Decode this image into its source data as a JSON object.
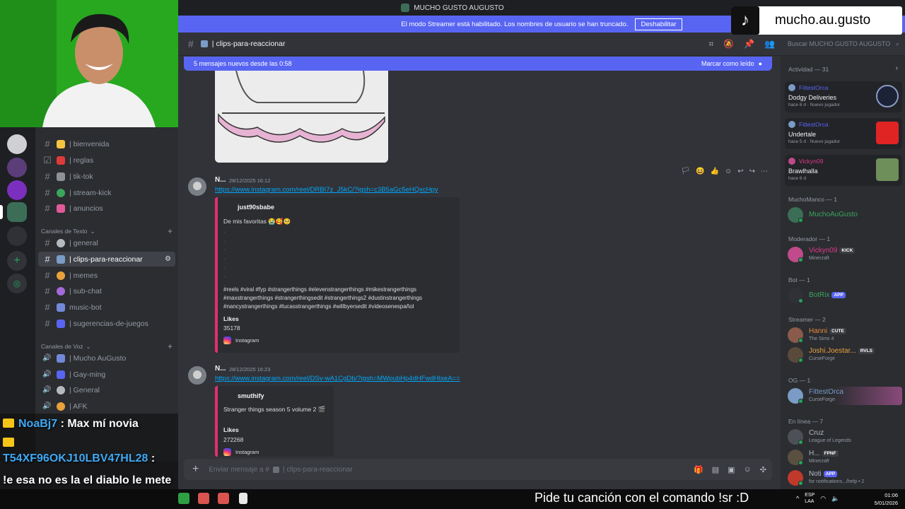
{
  "window": {
    "title": "MUCHO GUSTO AUGUSTO"
  },
  "banner": {
    "text": "El modo Streamer está habilitado. Los nombres de usuario se han truncado.",
    "button": "Deshabilitar"
  },
  "header": {
    "channel": "| clips-para-reaccionar",
    "search_placeholder": "Buscar MUCHO GUSTO AUGUSTO"
  },
  "new_messages": {
    "text": "5 mensajes nuevos desde las 0:58",
    "mark_read": "Marcar como leído"
  },
  "sidebar": {
    "top_channels": [
      {
        "label": "| bienvenida",
        "color": "#f5c542"
      },
      {
        "label": "| reglas",
        "color": "#e03a3a"
      },
      {
        "label": "| tik-tok",
        "color": "#8e9297"
      },
      {
        "label": "| stream-kick",
        "color": "#3ba55c"
      },
      {
        "label": "| anuncios",
        "color": "#e05a9a"
      }
    ],
    "text_category": "Canales de Texto",
    "text_channels": [
      {
        "label": "| general",
        "color": "#b5bac1"
      },
      {
        "label": "| clips-para-reaccionar",
        "color": "#7a9cc6"
      },
      {
        "label": "| memes",
        "color": "#e9a23b"
      },
      {
        "label": "| sub-chat",
        "color": "#a56ad9"
      },
      {
        "label": "music-bot",
        "color": "#7289da"
      },
      {
        "label": "| sugerencias-de-juegos",
        "color": "#5865f2"
      }
    ],
    "voice_category": "Canales de Voz",
    "voice_channels": [
      {
        "label": "| Mucho AuGusto",
        "color": "#7289da"
      },
      {
        "label": "| Gay-ming",
        "color": "#5865f2"
      },
      {
        "label": "| General",
        "color": "#b5bac1"
      },
      {
        "label": "| AFK",
        "color": "#e9a23b"
      }
    ]
  },
  "messages": [
    {
      "user": "N...",
      "time": "28/12/2025 16:12",
      "link": "https://www.instagram.com/reel/DRBI7z_J5kC/?igsh=c3B5aGc5eHQxcHpy",
      "embed": {
        "author": "just90sbabe",
        "desc": "De mis favoritas 😭🥰🥺",
        "tags": "#reels #viral #fyp #strangerthings #elevenstrangerthings #mikestrangerthings #maxstrangerthings #strangerthingsedit #strangerthings2 #dustinstrangerthings #nancystrangerthings #lucasstrangerthings #willbyersedit #videosenespañol",
        "likes_label": "Likes",
        "likes": "35178",
        "footer": "Instagram"
      }
    },
    {
      "user": "N...",
      "time": "28/12/2025 16:23",
      "link": "https://www.instagram.com/reel/DSv-wA1CgDb/?igsh=MWpubHp4dHFwdHIxeA==",
      "embed": {
        "author": "smuthify",
        "desc": "Stranger things season 5 volume 2 🎬",
        "likes_label": "Likes",
        "likes": "272268",
        "footer": "Instagram"
      }
    }
  ],
  "composer": {
    "placeholder": "Enviar mensaje a #",
    "channel": "| clips-para-reaccionar"
  },
  "members": {
    "activity_title": "Actividad — 31",
    "activities": [
      {
        "name": "FittestOrca",
        "game": "Dodgy Deliveries",
        "time": "hace 6 d",
        "tag": "Nuevo jugador"
      },
      {
        "name": "FittestOrca",
        "game": "Undertale",
        "time": "hace 5 d",
        "tag": "Nuevo jugador"
      },
      {
        "name": "Vickyn09",
        "game": "Brawlhalla",
        "time": "hace 6 d",
        "tag": ""
      }
    ],
    "groups": [
      {
        "title": "MuchoManco — 1",
        "items": [
          {
            "name": "MuchoAuGusto",
            "color": "#3ba55c",
            "sub": "",
            "badge": ""
          }
        ]
      },
      {
        "title": "Moderador — 1",
        "items": [
          {
            "name": "Vickyn09",
            "color": "#e03a8a",
            "sub": "Minecraft",
            "badge": "KICK"
          }
        ]
      },
      {
        "title": "Bot — 1",
        "items": [
          {
            "name": "BotRix",
            "color": "#3ba55c",
            "sub": "",
            "badge": "APP"
          }
        ]
      },
      {
        "title": "Streamer — 2",
        "items": [
          {
            "name": "Hanni",
            "color": "#e98a3b",
            "sub": "The Sims 4",
            "badge": "CUTE"
          },
          {
            "name": "Joshi.Joestar...",
            "color": "#e9a23b",
            "sub": "CurseForge",
            "badge": "RVLS"
          }
        ]
      },
      {
        "title": "OG — 1",
        "items": [
          {
            "name": "FittestOrca",
            "color": "#7a9cc6",
            "sub": "CurseForge",
            "badge": ""
          }
        ]
      },
      {
        "title": "En línea — 7",
        "items": [
          {
            "name": "Cruz",
            "color": "#b5bac1",
            "sub": "League of Legends",
            "badge": ""
          },
          {
            "name": "H...",
            "color": "#b5bac1",
            "sub": "Minecraft",
            "badge": "FPNF"
          },
          {
            "name": "Noti",
            "color": "#b5bac1",
            "sub": "for notifications.../help • 2",
            "badge": "APP"
          }
        ]
      }
    ]
  },
  "overlay": {
    "tiktok_handle": "mucho.au.gusto",
    "chat": [
      {
        "user": "NoaBj7",
        "text": "Max mí novia"
      },
      {
        "user": "T54XF96OKJ10LBV47HL28",
        "text": "!e esa no es la el diablo le mete el chile hasta el fondo?"
      }
    ]
  },
  "taskbar": {
    "ticker": "Pide tu canción con el comando !sr :D",
    "lang": "ESP",
    "region": "LAA",
    "time": "01:06",
    "date": "5/01/2026"
  }
}
